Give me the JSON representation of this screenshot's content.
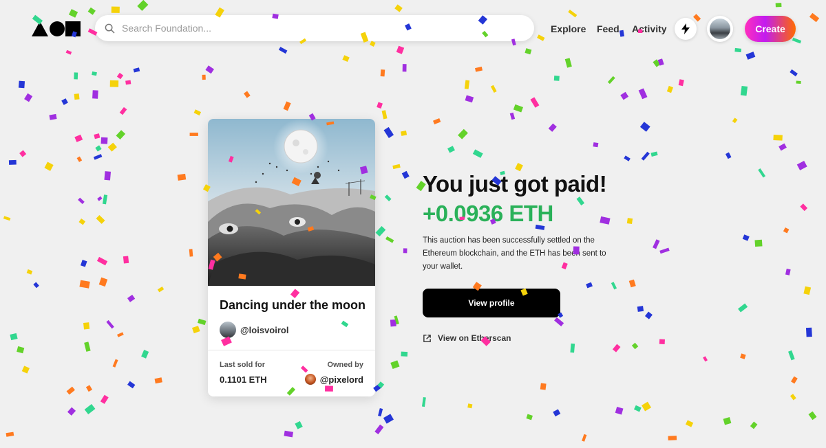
{
  "header": {
    "logo_alt": "Foundation",
    "search_placeholder": "Search Foundation...",
    "nav": [
      "Explore",
      "Feed",
      "Activity"
    ],
    "create_label": "Create"
  },
  "card": {
    "title": "Dancing under the moon",
    "creator": "@loisvoirol",
    "last_sold_label": "Last sold for",
    "last_sold_value": "0.1101 ETH",
    "owned_by_label": "Owned by",
    "owner": "@pixelord"
  },
  "main": {
    "headline": "You just got paid!",
    "amount": "+0.0936 ETH",
    "description": "This auction has been successfully settled on the Ethereum blockchain, and the ETH has been sent to your wallet.",
    "view_profile_label": "View profile",
    "etherscan_label": "View on Etherscan"
  },
  "colors": {
    "accent_green": "#2ab159",
    "confetti": [
      "#2436d6",
      "#ff7a1f",
      "#31d78f",
      "#a02fe0",
      "#f5d20a",
      "#63d22a",
      "#ff2fa0"
    ]
  }
}
